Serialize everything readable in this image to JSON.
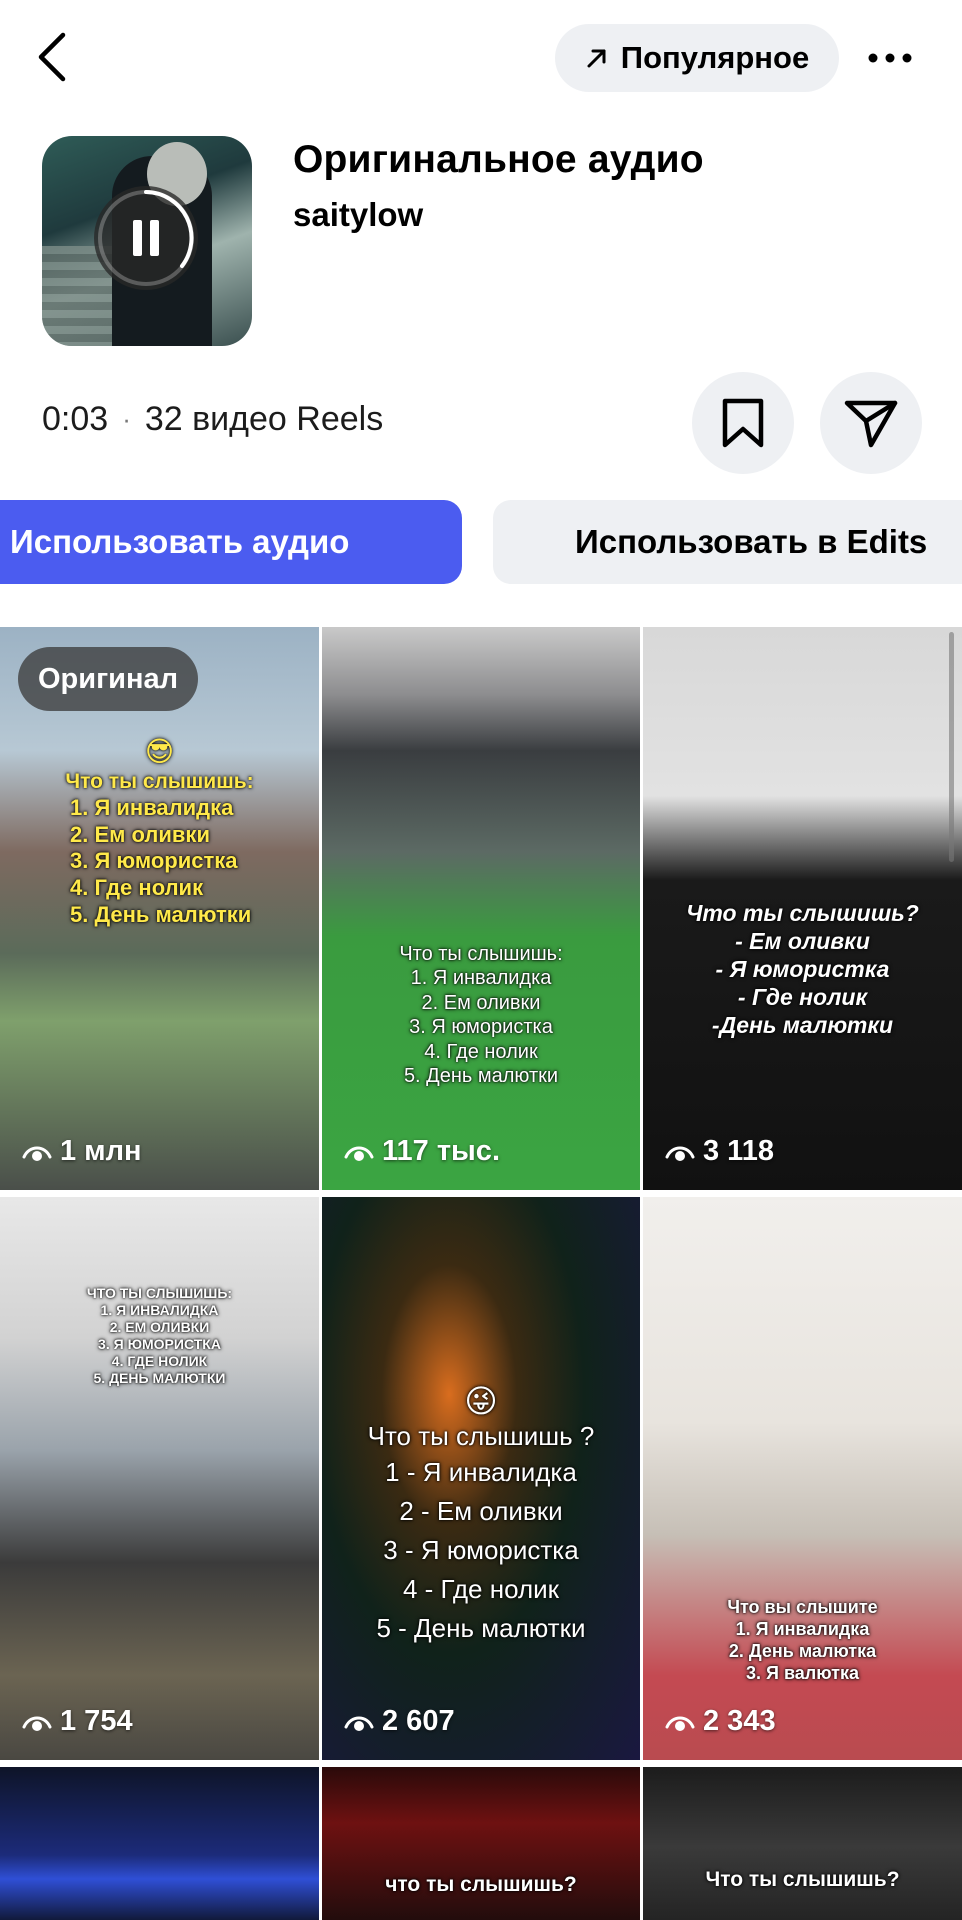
{
  "header": {
    "back_icon": "chevron-left-icon",
    "popular_label": "Популярное",
    "popular_icon": "arrow-up-right-icon",
    "more_icon": "ellipsis-icon"
  },
  "audio": {
    "title": "Оригинальное аудио",
    "author": "saitylow",
    "time": "0:03",
    "separator": "·",
    "reels_count": "32 видео Reels",
    "playback_icon": "pause-icon"
  },
  "actions": {
    "save_icon": "bookmark-icon",
    "share_icon": "send-icon",
    "use_audio_label": "Использовать аудио",
    "use_edits_label": "Использовать в Edits",
    "accent_color": "#4b5cf0"
  },
  "grid": {
    "badge_label": "Оригинал",
    "tiles": [
      {
        "views": "1 млн",
        "emoji": "😎",
        "lines": [
          "Что ты слышишь:",
          "1. Я инвалидка",
          "2. Ем оливки",
          "3. Я юмористка",
          "4. Где нолик",
          "5. День малютки"
        ]
      },
      {
        "views": "117 тыс.",
        "lines": [
          "Что ты слышишь:",
          "1. Я инвалидка",
          "2. Ем оливки",
          "3. Я юмористка",
          "4. Где нолик",
          "5. День малютки"
        ]
      },
      {
        "views": "3 118",
        "lines": [
          "Что ты слышишь?",
          "- Ем оливки",
          "- Я юмористка",
          "- Где нолик",
          "-День малютки"
        ]
      },
      {
        "views": "1 754",
        "lines": [
          "ЧТО ТЫ СЛЫШИШЬ:",
          "1. Я ИНВАЛИДКА",
          "2. ЕМ ОЛИВКИ",
          "3. Я ЮМОРИСТКА",
          "4. ГДЕ НОЛИК",
          "5. ДЕНЬ МАЛЮТКИ"
        ]
      },
      {
        "views": "2 607",
        "emoji": "😜",
        "lines": [
          "Что ты слышишь ?",
          "1 - Я инвалидка",
          "2 - Ем оливки",
          "3 - Я юмористка",
          "4 - Где нолик",
          "5 - День малютки"
        ]
      },
      {
        "views": "2 343",
        "lines": [
          "Что вы слышите",
          "1. Я инвалидка",
          "2. День малютка",
          "3. Я валютка"
        ]
      },
      {
        "lines": []
      },
      {
        "lines": [
          "что ты слышишь?"
        ]
      },
      {
        "lines": [
          "Что ты слышишь?"
        ]
      }
    ]
  }
}
